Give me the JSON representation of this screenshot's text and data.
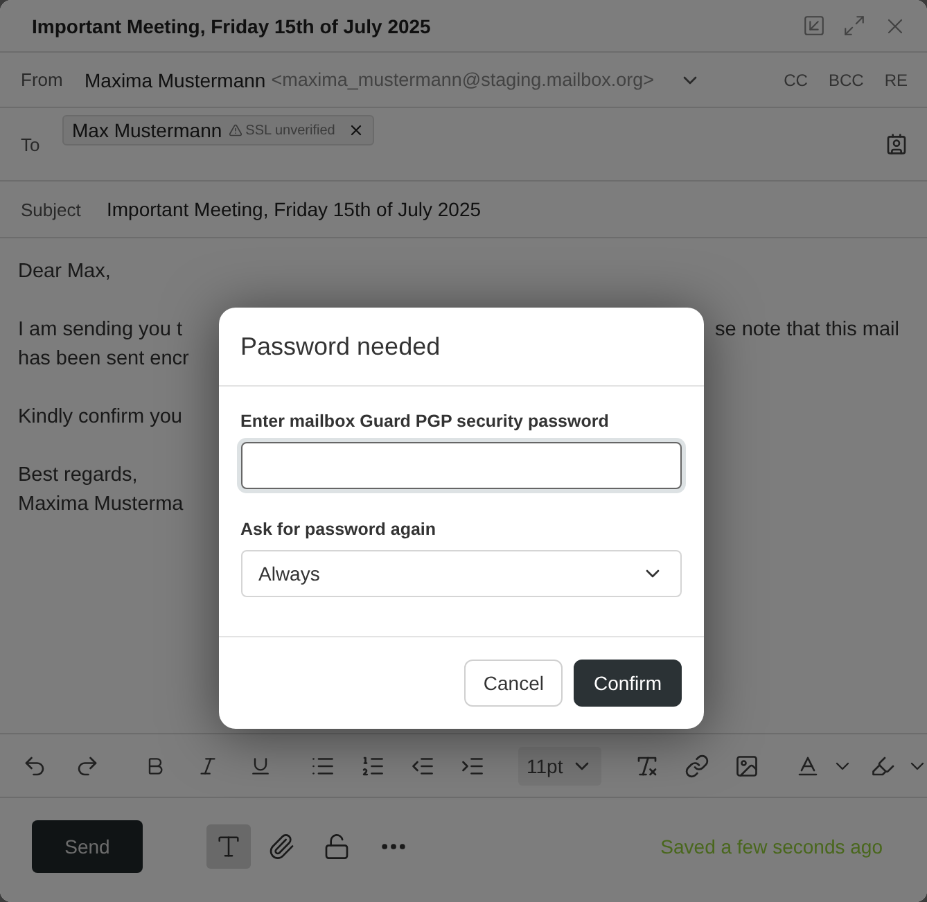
{
  "window": {
    "title": "Important Meeting, Friday 15th of July 2025"
  },
  "from": {
    "label": "From",
    "name": "Maxima Mustermann",
    "address": "<maxima_mustermann@staging.mailbox.org>"
  },
  "copy_buttons": [
    "CC",
    "BCC",
    "RE"
  ],
  "to": {
    "label": "To",
    "recipients": [
      {
        "name": "Max Mustermann",
        "warning": "SSL unverified"
      }
    ]
  },
  "subject": {
    "label": "Subject",
    "value": "Important Meeting, Friday 15th of July 2025"
  },
  "body": {
    "paragraphs": [
      {
        "lines": [
          {
            "left": "Dear Max,"
          }
        ]
      },
      {
        "lines": [
          {
            "left": "I am sending you t",
            "right": "se note that this mail"
          },
          {
            "left": "has been sent encr"
          }
        ]
      },
      {
        "lines": [
          {
            "left": "Kindly confirm you"
          }
        ]
      },
      {
        "lines": [
          {
            "left": "Best regards,"
          },
          {
            "left": "Maxima Musterma"
          }
        ]
      }
    ]
  },
  "toolbar": {
    "font_size": "11pt"
  },
  "footer": {
    "send": "Send",
    "format_toggle": {
      "selected": true
    },
    "status": "Saved a few seconds ago"
  },
  "dialog": {
    "title": "Password needed",
    "password_label": "Enter mailbox Guard PGP security password",
    "ask_label": "Ask for password again",
    "ask_value": "Always",
    "buttons": [
      {
        "label": "Cancel",
        "kind": "secondary"
      },
      {
        "label": "Confirm",
        "kind": "primary"
      }
    ]
  }
}
